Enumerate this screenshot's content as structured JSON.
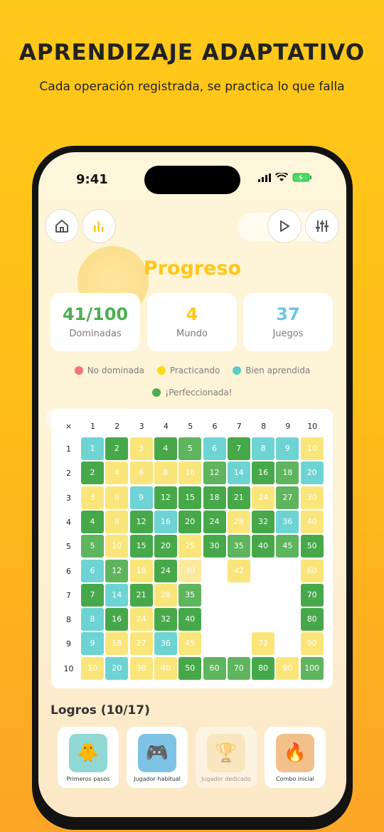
{
  "headline": "APRENDIZAJE ADAPTATIVO",
  "subheadline": "Cada operación registrada, se practica lo que falla",
  "status_bar": {
    "time": "9:41"
  },
  "nav": {
    "home_icon": "home-icon",
    "stats_icon": "bar-chart-icon",
    "play_icon": "play-icon",
    "settings_icon": "sliders-icon"
  },
  "page_title": "Progreso",
  "stats": [
    {
      "value": "41/100",
      "label": "Dominadas",
      "color": "#4CAF50"
    },
    {
      "value": "4",
      "label": "Mundo",
      "color": "#FFC61A"
    },
    {
      "value": "37",
      "label": "Juegos",
      "color": "#6EC6DC"
    }
  ],
  "legend": [
    {
      "label": "No dominada",
      "color": "#F07676"
    },
    {
      "label": "Practicando",
      "color": "#FFD81A"
    },
    {
      "label": "Bien aprendida",
      "color": "#5ACCC6"
    },
    {
      "label": "¡Perfeccionada!",
      "color": "#4CAF50"
    }
  ],
  "grid": {
    "corner": "×",
    "header": [
      "1",
      "2",
      "3",
      "4",
      "5",
      "6",
      "7",
      "8",
      "9",
      "10"
    ],
    "status_colors": {
      "G": "#47A84A",
      "g": "#5EB55E",
      "T": "#6DD4D3",
      "Y": "#FAE57A",
      "P": "#FBEA9E",
      "E": "#FFFFFF"
    },
    "rows": [
      [
        "T",
        "G",
        "Y",
        "G",
        "g",
        "T",
        "G",
        "T",
        "T",
        "Y"
      ],
      [
        "G",
        "Y",
        "Y",
        "Y",
        "Y",
        "g",
        "T",
        "G",
        "g",
        "T"
      ],
      [
        "Y",
        "Y",
        "T",
        "G",
        "G",
        "G",
        "G",
        "Y",
        "g",
        "Y"
      ],
      [
        "G",
        "Y",
        "G",
        "T",
        "G",
        "G",
        "Y",
        "G",
        "T",
        "Y"
      ],
      [
        "g",
        "Y",
        "G",
        "G",
        "Y",
        "G",
        "g",
        "G",
        "g",
        "G"
      ],
      [
        "T",
        "g",
        "Y",
        "G",
        "P",
        "E",
        "Y",
        "E",
        "E",
        "Y"
      ],
      [
        "G",
        "T",
        "G",
        "Y",
        "g",
        "E",
        "E",
        "E",
        "E",
        "G"
      ],
      [
        "T",
        "G",
        "Y",
        "G",
        "G",
        "E",
        "E",
        "E",
        "E",
        "G"
      ],
      [
        "T",
        "Y",
        "Y",
        "T",
        "Y",
        "E",
        "E",
        "Y",
        "E",
        "Y"
      ],
      [
        "Y",
        "T",
        "Y",
        "Y",
        "G",
        "g",
        "g",
        "G",
        "Y",
        "g"
      ]
    ]
  },
  "logros": {
    "title": "Logros (10/17)",
    "items": [
      {
        "label": "Primeros pasos",
        "icon": "chick-icon",
        "color": "#D9A441",
        "dim": false
      },
      {
        "label": "Jugador habitual",
        "icon": "gamepad-icon",
        "color": "#5B9FD6",
        "dim": false
      },
      {
        "label": "Jugador dedicado",
        "icon": "trophy-icon",
        "color": "#E7C16A",
        "dim": true
      },
      {
        "label": "Combo inicial",
        "icon": "fire-icon",
        "color": "#EF8A4A",
        "dim": false
      }
    ]
  }
}
